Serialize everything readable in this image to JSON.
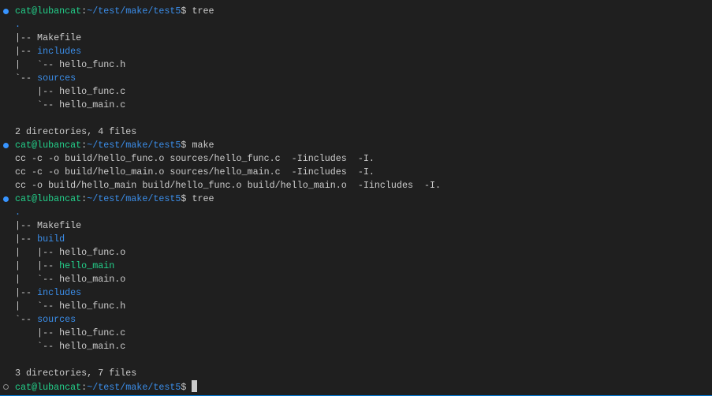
{
  "colors": {
    "background": "#1f1f1f",
    "text": "#cccccc",
    "user_host": "#23d18b",
    "path": "#3b8eea",
    "directory": "#3b8eea",
    "executable": "#23d18b",
    "prompt_success_mark": "#3794ff"
  },
  "terminal": {
    "lines": [
      {
        "segments": [
          {
            "t": "Makefile  ",
            "c": "w"
          },
          {
            "t": "includes",
            "c": "b"
          },
          {
            "t": "  ",
            "c": "w"
          },
          {
            "t": "sources",
            "c": "b"
          }
        ]
      },
      {
        "mark": "ok",
        "segments": [
          {
            "t": "cat@lubancat",
            "c": "g"
          },
          {
            "t": ":",
            "c": "w"
          },
          {
            "t": "~/test/make/test5",
            "c": "b"
          },
          {
            "t": "$ tree",
            "c": "w"
          }
        ]
      },
      {
        "segments": [
          {
            "t": ".",
            "c": "b"
          }
        ]
      },
      {
        "segments": [
          {
            "t": "|-- Makefile",
            "c": "w"
          }
        ]
      },
      {
        "segments": [
          {
            "t": "|-- ",
            "c": "w"
          },
          {
            "t": "includes",
            "c": "b"
          }
        ]
      },
      {
        "segments": [
          {
            "t": "|   `-- hello_func.h",
            "c": "w"
          }
        ]
      },
      {
        "segments": [
          {
            "t": "`-- ",
            "c": "w"
          },
          {
            "t": "sources",
            "c": "b"
          }
        ]
      },
      {
        "segments": [
          {
            "t": "    |-- hello_func.c",
            "c": "w"
          }
        ]
      },
      {
        "segments": [
          {
            "t": "    `-- hello_main.c",
            "c": "w"
          }
        ]
      },
      {
        "segments": []
      },
      {
        "segments": [
          {
            "t": "2 directories, 4 files",
            "c": "w"
          }
        ]
      },
      {
        "mark": "ok",
        "segments": [
          {
            "t": "cat@lubancat",
            "c": "g"
          },
          {
            "t": ":",
            "c": "w"
          },
          {
            "t": "~/test/make/test5",
            "c": "b"
          },
          {
            "t": "$ make",
            "c": "w"
          }
        ]
      },
      {
        "segments": [
          {
            "t": "cc -c -o build/hello_func.o sources/hello_func.c  -Iincludes  -I.",
            "c": "w"
          }
        ]
      },
      {
        "segments": [
          {
            "t": "cc -c -o build/hello_main.o sources/hello_main.c  -Iincludes  -I.",
            "c": "w"
          }
        ]
      },
      {
        "segments": [
          {
            "t": "cc -o build/hello_main build/hello_func.o build/hello_main.o  -Iincludes  -I.",
            "c": "w"
          }
        ]
      },
      {
        "mark": "ok",
        "segments": [
          {
            "t": "cat@lubancat",
            "c": "g"
          },
          {
            "t": ":",
            "c": "w"
          },
          {
            "t": "~/test/make/test5",
            "c": "b"
          },
          {
            "t": "$ tree",
            "c": "w"
          }
        ]
      },
      {
        "segments": [
          {
            "t": ".",
            "c": "b"
          }
        ]
      },
      {
        "segments": [
          {
            "t": "|-- Makefile",
            "c": "w"
          }
        ]
      },
      {
        "segments": [
          {
            "t": "|-- ",
            "c": "w"
          },
          {
            "t": "build",
            "c": "b"
          }
        ]
      },
      {
        "segments": [
          {
            "t": "|   |-- hello_func.o",
            "c": "w"
          }
        ]
      },
      {
        "segments": [
          {
            "t": "|   |-- ",
            "c": "w"
          },
          {
            "t": "hello_main",
            "c": "g"
          }
        ]
      },
      {
        "segments": [
          {
            "t": "|   `-- hello_main.o",
            "c": "w"
          }
        ]
      },
      {
        "segments": [
          {
            "t": "|-- ",
            "c": "w"
          },
          {
            "t": "includes",
            "c": "b"
          }
        ]
      },
      {
        "segments": [
          {
            "t": "|   `-- hello_func.h",
            "c": "w"
          }
        ]
      },
      {
        "segments": [
          {
            "t": "`-- ",
            "c": "w"
          },
          {
            "t": "sources",
            "c": "b"
          }
        ]
      },
      {
        "segments": [
          {
            "t": "    |-- hello_func.c",
            "c": "w"
          }
        ]
      },
      {
        "segments": [
          {
            "t": "    `-- hello_main.c",
            "c": "w"
          }
        ]
      },
      {
        "segments": []
      },
      {
        "segments": [
          {
            "t": "3 directories, 7 files",
            "c": "w"
          }
        ]
      },
      {
        "mark": "idle",
        "cursor": true,
        "segments": [
          {
            "t": "cat@lubancat",
            "c": "g"
          },
          {
            "t": ":",
            "c": "w"
          },
          {
            "t": "~/test/make/test5",
            "c": "b"
          },
          {
            "t": "$ ",
            "c": "w"
          }
        ]
      }
    ]
  }
}
